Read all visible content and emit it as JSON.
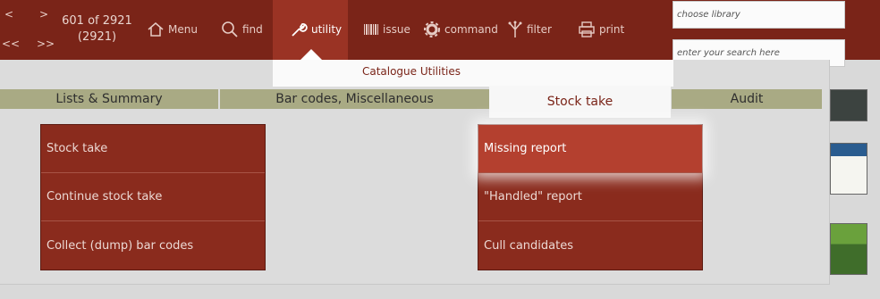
{
  "nav": {
    "prev": "<",
    "next": ">",
    "first": "<<",
    "last": ">>"
  },
  "record": {
    "position": "601 of 2921",
    "total": "(2921)"
  },
  "toolbar": {
    "menu": "Menu",
    "find": "find",
    "utility": "utility",
    "issue": "issue",
    "command": "command",
    "filter": "filter",
    "print": "print"
  },
  "library": {
    "placeholder": "choose library"
  },
  "search": {
    "placeholder": "enter your search here"
  },
  "panel": {
    "title": "Catalogue Utilities"
  },
  "tabs": [
    "Lists & Summary",
    "Bar codes, Miscellaneous",
    "Stock take",
    "Audit"
  ],
  "active_tab": "Stock take",
  "left_menu": [
    "Stock take",
    "Continue stock take",
    "Collect (dump) bar codes"
  ],
  "right_menu": [
    "Missing report",
    "\"Handled\" report",
    "Cull candidates"
  ],
  "colors": {
    "toolbar": "#7a2418",
    "menu": "#8a2b1d",
    "tab": "#a9aa84",
    "highlight": "#b4402f"
  }
}
